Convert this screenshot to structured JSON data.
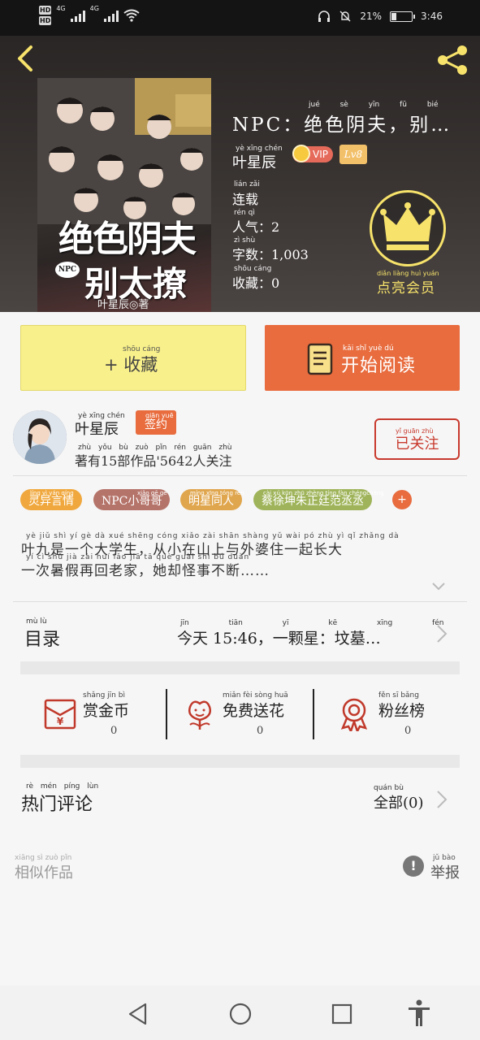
{
  "status_bar": {
    "hd1": "HD",
    "hd2": "HD",
    "net1": "4G",
    "net2": "4G",
    "battery_pct_text": "21%",
    "battery_level": 0.21,
    "time": "3:46"
  },
  "book": {
    "cover_title_line1": "绝色阴夫",
    "cover_title_line2": "别太撩",
    "cover_badge": "NPC",
    "cover_author": "叶星辰◎著",
    "title": "NPC：绝色阴夫，别…",
    "title_pinyin": [
      "jué",
      "sè",
      "yīn",
      "fū",
      "bié"
    ],
    "author": "叶星辰",
    "author_pinyin": "yè xīng chén",
    "vip": "VIP",
    "level": "Lv8",
    "status": "连载",
    "status_pinyin": "lián zǎi",
    "popularity": "人气：2",
    "popularity_pinyin": "rén qì",
    "word_count": "字数：1,003",
    "word_count_pinyin": "zì shù",
    "favorites": "收藏：0",
    "favorites_pinyin": "shōu cáng",
    "vip_button_label": "点亮会员",
    "vip_button_pinyin": "diǎn liàng huì yuán"
  },
  "actions": {
    "collect_label": "+ 收藏",
    "collect_pinyin": "shōu cáng",
    "read_label": "开始阅读",
    "read_pinyin": "kāi shǐ yuè dú"
  },
  "author_card": {
    "name": "叶星辰",
    "name_pinyin": "yè xīng chén",
    "signed": "签约",
    "signed_pinyin": "qiān yuē",
    "stats": "著有15部作品'5642人关注",
    "stats_pinyin": "zhù yǒu bù zuò pǐn rén guān zhù",
    "follow_label": "已关注",
    "follow_pinyin": "yǐ guān zhù"
  },
  "tags": [
    {
      "label": "灵异言情",
      "pinyin": "líng yì yán qíng",
      "color": "#f0a83e"
    },
    {
      "label": "NPC小哥哥",
      "pinyin": "xiǎo gē ge",
      "color": "#b5746a"
    },
    {
      "label": "明星同人",
      "pinyin": "míng xīng tóng rén",
      "color": "#e0a64e"
    },
    {
      "label": "蔡徐坤朱正廷范丞丞",
      "pinyin": "cài xú kūn zhū zhèng tíng fàn chéngchéng",
      "color": "#9fb45a"
    }
  ],
  "tag_more": "+",
  "synopsis": {
    "line1": "叶九是一个大学生，从小在山上与外婆住一起长大",
    "line1_pinyin": "yè jiǔ shì yí gè dà xué shēng   cóng xiǎo zài shān shàng yǔ wài pó zhù yì qǐ zhǎng dà",
    "line2": "一次暑假再回老家，她却怪事不断……",
    "line2_pinyin": "yí cì shǔ jià zài huí lǎo jiā   tā què guài shì bú duàn"
  },
  "catalog": {
    "label": "目录",
    "label_pinyin": "mù lù",
    "latest": "今天 15:46，一颗星：坟墓…",
    "latest_pinyin": "jīn tiān   yī kē xīng   fén mù"
  },
  "rewards": [
    {
      "label": "赏金币",
      "pinyin": "shǎng jīn bì",
      "count": "0",
      "icon": "red-envelope-icon"
    },
    {
      "label": "免费送花",
      "pinyin": "miǎn fèi sòng huā",
      "count": "0",
      "icon": "flower-icon"
    },
    {
      "label": "粉丝榜",
      "pinyin": "fěn sī bǎng",
      "count": "0",
      "icon": "medal-icon"
    }
  ],
  "comments": {
    "label": "热门评论",
    "label_pinyin": "rè mén píng lùn",
    "all_label": "全部(0)",
    "all_pinyin": "quán bù"
  },
  "similar": {
    "label": "相似作品",
    "pinyin": "xiāng sì zuò pǐn"
  },
  "report": {
    "label": "举报",
    "pinyin": "jǔ bào",
    "icon_text": "!"
  },
  "colors": {
    "accent_orange": "#e86c3e",
    "collect_yellow": "#f8f08a",
    "follow_red": "#c8392d",
    "crown_yellow": "#f7e36b"
  }
}
